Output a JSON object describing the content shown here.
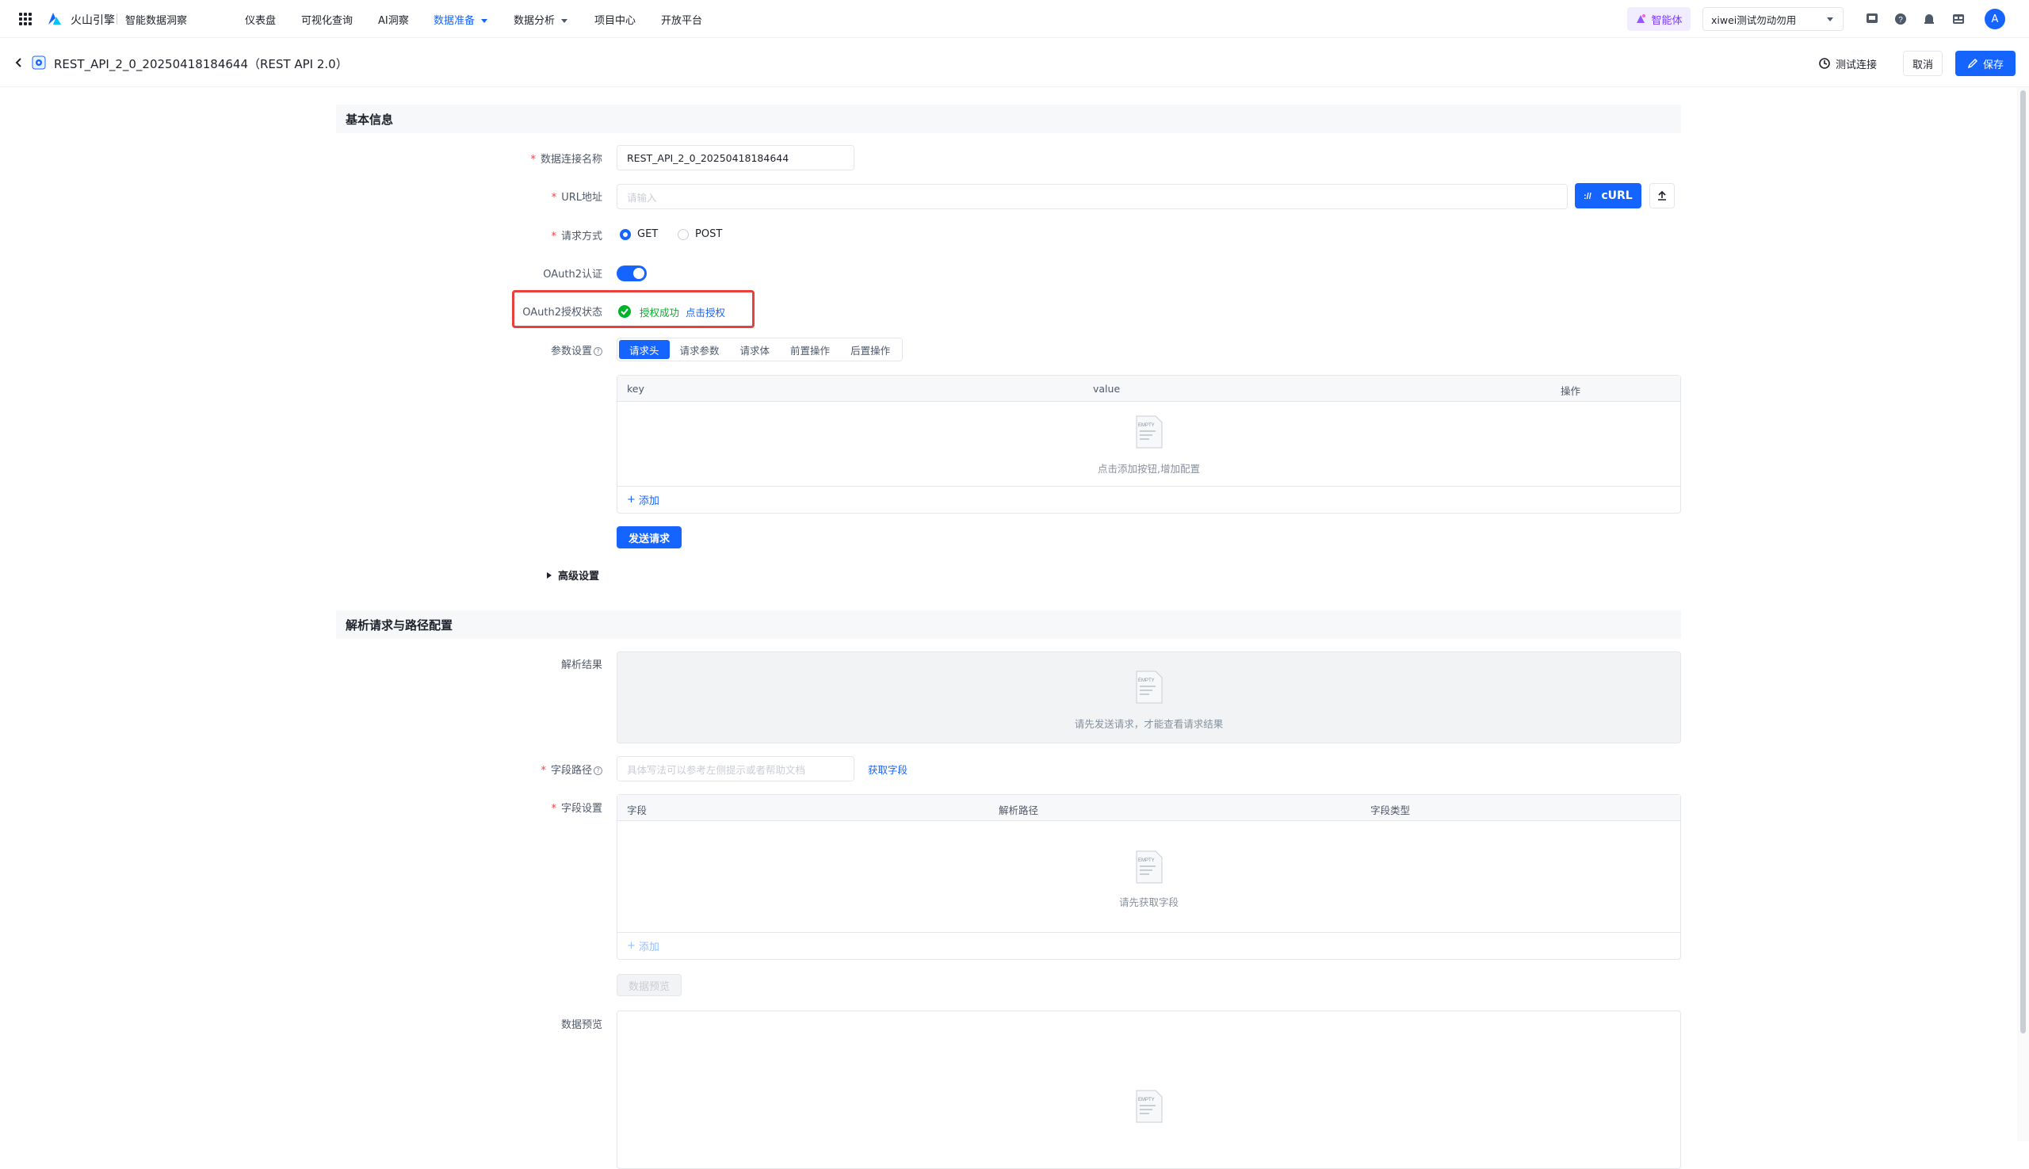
{
  "nav": {
    "brand": "火山引擎",
    "product": "智能数据洞察",
    "menus": [
      "仪表盘",
      "可视化查询",
      "AI洞察",
      "数据准备",
      "数据分析",
      "项目中心",
      "开放平台"
    ],
    "agent_label": "智能体",
    "tenant": "xiwei测试勿动勿用",
    "avatar": "A"
  },
  "header": {
    "title": "REST_API_2_0_20250418184644（REST API 2.0）",
    "test_connection": "测试连接",
    "cancel": "取消",
    "save": "保存"
  },
  "basic": {
    "section_title": "基本信息",
    "name_label": "数据连接名称",
    "name_value": "REST_API_2_0_20250418184644",
    "url_label": "URL地址",
    "url_placeholder": "请输入",
    "curl_label": "cURL",
    "method_label": "请求方式",
    "method_get": "GET",
    "method_post": "POST",
    "oauth_label": "OAuth2认证",
    "oauth_status_label": "OAuth2授权状态",
    "oauth_status": "授权成功",
    "oauth_link": "点击授权",
    "params_label": "参数设置",
    "tabs": [
      "请求头",
      "请求参数",
      "请求体",
      "前置操作",
      "后置操作"
    ],
    "params_table": {
      "columns": [
        "key",
        "value",
        "操作"
      ],
      "empty_text": "点击添加按钮,增加配置",
      "add_label": "添加"
    },
    "send_request": "发送请求",
    "advanced": "高级设置"
  },
  "parse": {
    "section_title": "解析请求与路径配置",
    "result_label": "解析结果",
    "result_empty": "请先发送请求，才能查看请求结果",
    "path_label": "字段路径",
    "path_placeholder": "具体写法可以参考左侧提示或者帮助文档",
    "get_field": "获取字段",
    "fields_label": "字段设置",
    "fields_table": {
      "columns": [
        "字段",
        "解析路径",
        "字段类型"
      ],
      "empty_text": "请先获取字段",
      "add_label": "添加"
    },
    "preview_button": "数据预览",
    "preview_label": "数据预览"
  },
  "empty_icon_text": "EMPTY",
  "colors": {
    "primary": "#1664ff",
    "success": "#00b42a",
    "required": "#f53f3f",
    "highlight_border": "#e8403a",
    "agent": "#7b3bff"
  }
}
